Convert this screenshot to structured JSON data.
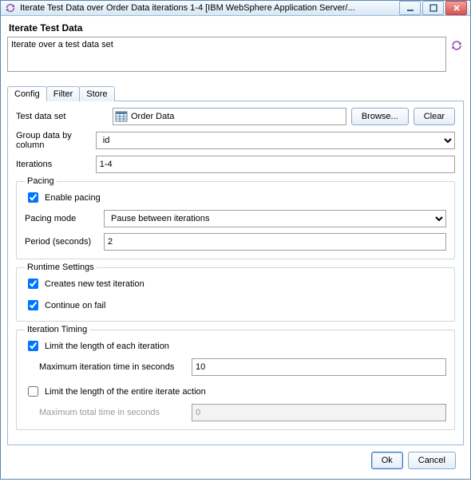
{
  "window": {
    "title": "Iterate Test Data  over Order Data iterations 1-4 [IBM WebSphere Application Server/..."
  },
  "header": {
    "heading": "Iterate Test Data",
    "description": "Iterate over a test data set"
  },
  "tabs": {
    "config": "Config",
    "filter": "Filter",
    "store": "Store"
  },
  "config": {
    "testDataSetLabel": "Test data set",
    "testDataSetValue": "Order Data",
    "browse": "Browse...",
    "clear": "Clear",
    "groupByLabel": "Group data by column",
    "groupByValue": "id",
    "iterationsLabel": "Iterations",
    "iterationsValue": "1-4",
    "pacing": {
      "legend": "Pacing",
      "enable": "Enable pacing",
      "modeLabel": "Pacing mode",
      "modeValue": "Pause between iterations",
      "periodLabel": "Period (seconds)",
      "periodValue": "2"
    },
    "runtime": {
      "legend": "Runtime Settings",
      "newIteration": "Creates new test iteration",
      "continueOnFail": "Continue on fail"
    },
    "timing": {
      "legend": "Iteration Timing",
      "limitEach": "Limit the length of each iteration",
      "maxEachLabel": "Maximum iteration time in seconds",
      "maxEachValue": "10",
      "limitTotal": "Limit the length of the entire iterate action",
      "maxTotalLabel": "Maximum total time in seconds",
      "maxTotalValue": "0"
    }
  },
  "buttons": {
    "ok": "Ok",
    "cancel": "Cancel"
  }
}
